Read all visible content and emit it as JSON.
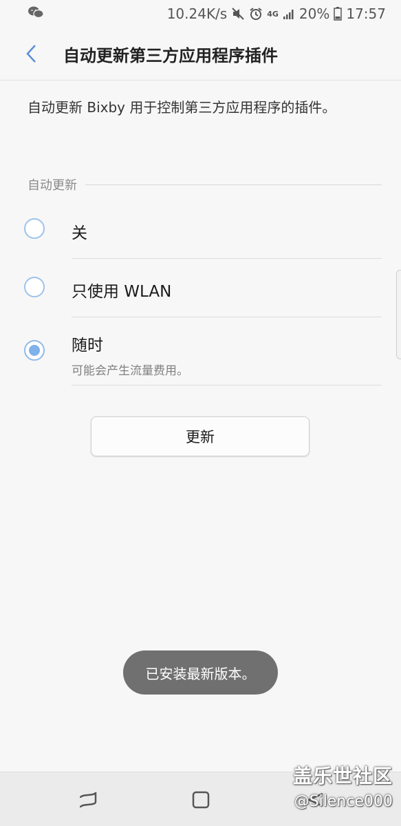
{
  "status_bar": {
    "speed": "10.24K/s",
    "network": "4G",
    "battery": "20%",
    "time": "17:57"
  },
  "header": {
    "title": "自动更新第三方应用程序插件"
  },
  "description": "自动更新 Bixby 用于控制第三方应用程序的插件。",
  "section": {
    "title": "自动更新"
  },
  "options": [
    {
      "label": "关",
      "subtext": "",
      "selected": false
    },
    {
      "label": "只使用 WLAN",
      "subtext": "",
      "selected": false
    },
    {
      "label": "随时",
      "subtext": "可能会产生流量费用。",
      "selected": true
    }
  ],
  "update_button": {
    "label": "更新"
  },
  "toast": {
    "message": "已安装最新版本。"
  },
  "watermark": {
    "line1": "盖乐世社区",
    "line2": "@Silence000"
  },
  "colors": {
    "accent": "#7fb1ea",
    "background": "#f7f7f7",
    "toast_bg": "#707070"
  }
}
